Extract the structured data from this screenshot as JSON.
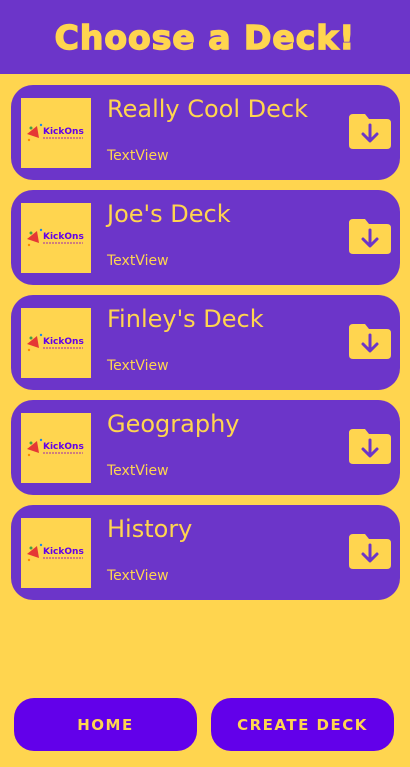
{
  "header": {
    "title": "Choose a Deck!"
  },
  "decks": [
    {
      "title": "Really Cool Deck",
      "subtitle": "TextView",
      "logo_text": "KickOns"
    },
    {
      "title": "Joe's Deck",
      "subtitle": "TextView",
      "logo_text": "KickOns"
    },
    {
      "title": "Finley's Deck",
      "subtitle": "TextView",
      "logo_text": "KickOns"
    },
    {
      "title": "Geography",
      "subtitle": "TextView",
      "logo_text": "KickOns"
    },
    {
      "title": "History",
      "subtitle": "TextView",
      "logo_text": "KickOns"
    }
  ],
  "buttons": {
    "home": "HOME",
    "create": "CREATE DECK"
  },
  "icons": {
    "download": "download-folder-icon",
    "logo": "kickons-logo-icon"
  },
  "colors": {
    "background": "#FFD54F",
    "card": "#6C35C9",
    "button": "#6200EA",
    "accent": "#FFD54F"
  }
}
